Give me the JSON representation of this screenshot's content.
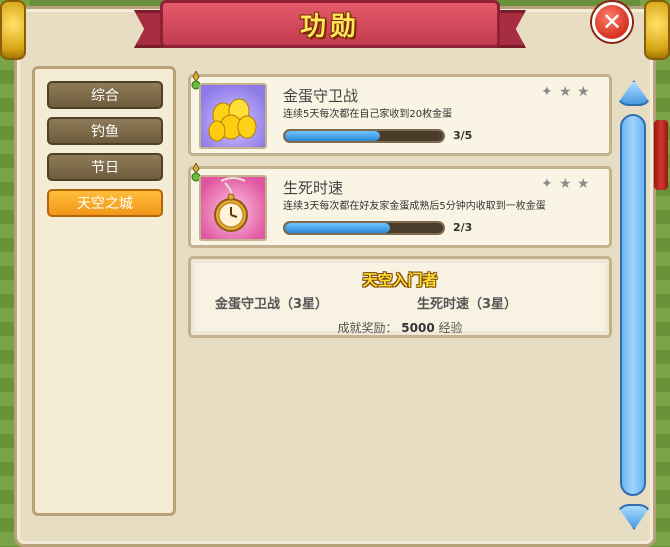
{
  "window": {
    "title": "功勋",
    "close_label": "✕"
  },
  "sidebar": {
    "items": [
      {
        "label": "综合",
        "active": false
      },
      {
        "label": "钓鱼",
        "active": false
      },
      {
        "label": "节日",
        "active": false
      },
      {
        "label": "天空之城",
        "active": true
      }
    ]
  },
  "achievements": [
    {
      "name": "金蛋守卫战",
      "description": "连续5天每次都在自己家收到20枚金蛋",
      "progress_text": "3/5",
      "progress": 0.6,
      "icon": "golden-eggs-icon",
      "stars_earned": 0,
      "stars_total": 3
    },
    {
      "name": "生死时速",
      "description": "连续3天每次都在好友家金蛋成熟后5分钟内收取到一枚金蛋",
      "progress_text": "2/3",
      "progress": 0.667,
      "icon": "pocket-watch-icon",
      "stars_earned": 0,
      "stars_total": 3
    }
  ],
  "summary": {
    "title": "天空入门者",
    "requirement_1": "金蛋守卫战（3星）",
    "requirement_2": "生死时速（3星）",
    "reward_label": "成就奖励：",
    "reward_amount": "5000",
    "reward_unit": "经验"
  },
  "colors": {
    "banner": "#c23b4f",
    "title_text": "#ffe55a",
    "active_tab": "#f2961a",
    "progress_fill": "#2b86d6",
    "scrollbar": "#6db6f0"
  }
}
